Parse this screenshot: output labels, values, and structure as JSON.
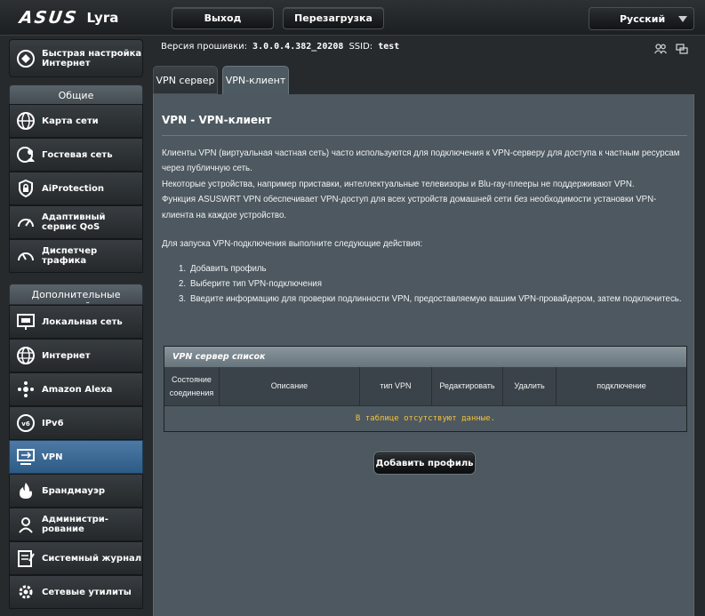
{
  "brand": {
    "name": "ASUS",
    "model": "Lyra"
  },
  "header": {
    "logout_label": "Выход",
    "reboot_label": "Перезагрузка",
    "language": "Русский"
  },
  "firmware": {
    "label": "Версия прошивки:",
    "version": "3.0.0.4.382_20208",
    "ssid_label": "SSID:",
    "ssid": "test"
  },
  "sidebar": {
    "quick_setup": "Быстрая настройка Интернет",
    "general_header": "Общие",
    "general": [
      {
        "label": "Карта сети",
        "icon": "network-map-icon"
      },
      {
        "label": "Гостевая сеть",
        "icon": "guest-network-icon"
      },
      {
        "label": "AiProtection",
        "icon": "shield-lock-icon"
      },
      {
        "label": "Адаптивный сервис QoS",
        "icon": "qos-gauge-icon"
      },
      {
        "label": "Диспетчер трафика",
        "icon": "traffic-gauge-icon"
      }
    ],
    "advanced_header": "Дополнительные настройки",
    "advanced": [
      {
        "label": "Локальная сеть",
        "icon": "lan-icon"
      },
      {
        "label": "Интернет",
        "icon": "globe-icon"
      },
      {
        "label": "Amazon Alexa",
        "icon": "alexa-icon"
      },
      {
        "label": "IPv6",
        "icon": "ipv6-icon"
      },
      {
        "label": "VPN",
        "icon": "vpn-icon",
        "active": true
      },
      {
        "label": "Брандмауэр",
        "icon": "firewall-icon"
      },
      {
        "label": "Администри-рование",
        "icon": "admin-gear-icon"
      },
      {
        "label": "Системный журнал",
        "icon": "syslog-icon"
      },
      {
        "label": "Сетевые утилиты",
        "icon": "network-tools-icon"
      }
    ]
  },
  "tabs": [
    {
      "label": "VPN сервер",
      "active": false
    },
    {
      "label": "VPN-клиент",
      "active": true
    }
  ],
  "page": {
    "title": "VPN - VPN-клиент",
    "description": [
      "Клиенты VPN (виртуальная частная сеть) часто используются для подключения к VPN-серверу для доступа к частным ресурсам через публичную сеть.",
      "Некоторые устройства, например приставки, интеллектуальные телевизоры и Blu-ray-плееры не поддерживают VPN.",
      "Функция ASUSWRT VPN обеспечивает VPN-доступ для всех устройств домашней сети без необходимости установки VPN-клиента на каждое устройство."
    ],
    "steps_intro": "Для запуска VPN-подключения выполните следующие действия:",
    "steps": [
      "Добавить профиль",
      "Выберите тип VPN-подключения",
      "Введите информацию для проверки подлинности VPN, предоставляемую вашим VPN-провайдером, затем подключитесь."
    ]
  },
  "table": {
    "title": "VPN сервер список",
    "columns": [
      "Состояние соединения",
      "Описание",
      "тип VPN",
      "Редактировать",
      "Удалить",
      "подключение"
    ],
    "empty_message": "В таблице отсутствуют данные."
  },
  "add_profile_label": "Добавить профиль",
  "colors": {
    "panel": "#4d5860",
    "active_menu": "#2c5b86",
    "empty_text": "#f5c338"
  }
}
